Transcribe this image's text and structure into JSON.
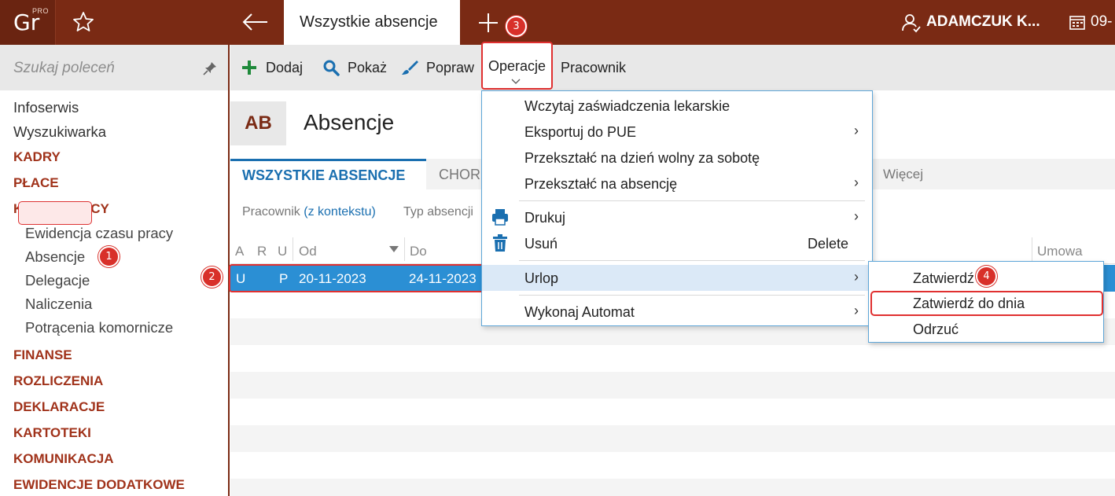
{
  "topbar": {
    "logo_text": "Gr",
    "logo_pro": "PRO",
    "tab_title": "Wszystkie absencje",
    "user_name": "ADAMCZUK K...",
    "date": "09-"
  },
  "sidebar": {
    "search_placeholder": "Szukaj poleceń",
    "items": [
      {
        "label": "Infoserwis"
      },
      {
        "label": "Wyszukiwarka"
      }
    ],
    "sections": [
      {
        "label": "KADRY"
      },
      {
        "label": "PŁACE"
      },
      {
        "label": "KARTA PRACY"
      },
      {
        "label": "FINANSE"
      },
      {
        "label": "ROZLICZENIA"
      },
      {
        "label": "DEKLARACJE"
      },
      {
        "label": "KARTOTEKI"
      },
      {
        "label": "KOMUNIKACJA"
      },
      {
        "label": "EWIDENCJE DODATKOWE"
      }
    ],
    "subitems": [
      {
        "label": "Ewidencja czasu pracy"
      },
      {
        "label": "Absencje"
      },
      {
        "label": "Delegacje"
      },
      {
        "label": "Naliczenia"
      },
      {
        "label": "Potrącenia komornicze"
      }
    ]
  },
  "toolbar": {
    "add_label": "Dodaj",
    "show_label": "Pokaż",
    "edit_label": "Popraw",
    "operations_label": "Operacje",
    "employee_label": "Pracownik"
  },
  "module": {
    "badge": "AB",
    "title": "Absencje"
  },
  "tabs": {
    "all": "WSZYSTKIE ABSENCJE",
    "chor": "CHOR",
    "more": "Więcej"
  },
  "filters": {
    "employee_prefix": "Pracownik ",
    "employee_context": "(z kontekstu)",
    "type": "Typ absencji"
  },
  "grid": {
    "headers": {
      "a": "A",
      "r": "R",
      "u": "U",
      "od": "Od",
      "do": "Do",
      "umowa": "Umowa"
    },
    "selected_row": {
      "a": "U",
      "r": "",
      "u": "P",
      "od": "20-11-2023",
      "do": "24-11-2023"
    }
  },
  "menu": {
    "items": [
      {
        "label": "Wczytaj zaświadczenia lekarskie"
      },
      {
        "label": "Eksportuj do PUE"
      },
      {
        "label": "Przekształć na dzień wolny za sobotę"
      },
      {
        "label": "Przekształć na absencję"
      },
      {
        "label": "Drukuj"
      },
      {
        "label": "Usuń",
        "shortcut": "Delete"
      },
      {
        "label": "Urlop"
      },
      {
        "label": "Wykonaj Automat"
      }
    ],
    "arrow": "›"
  },
  "submenu": {
    "items": [
      {
        "label": "Zatwierdź"
      },
      {
        "label": "Zatwierdź do dnia"
      },
      {
        "label": "Odrzuć"
      }
    ]
  },
  "badges": {
    "b1": "1",
    "b2": "2",
    "b3": "3",
    "b4": "4"
  },
  "colors": {
    "brand": "#7a2a14",
    "accent_blue": "#1a6fb0",
    "selection": "#2b8fd4",
    "highlight_red": "#e03030"
  }
}
